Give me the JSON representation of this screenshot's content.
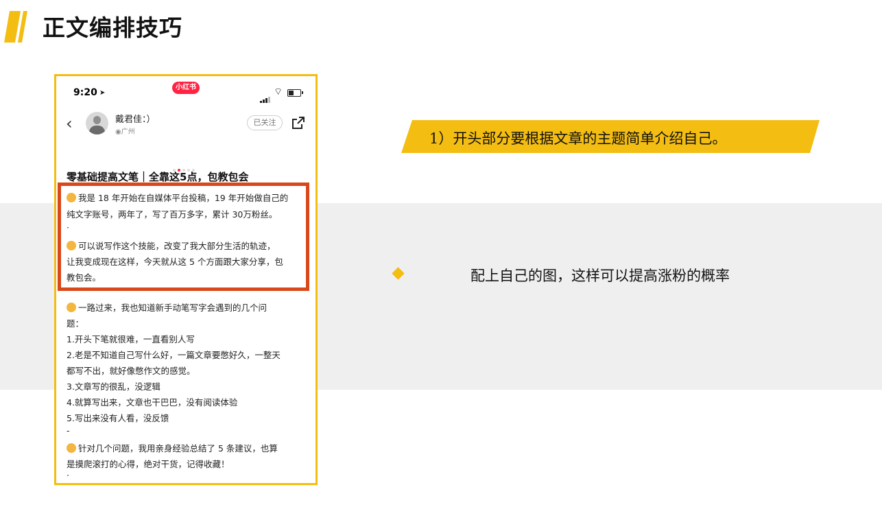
{
  "page": {
    "title": "正文编排技巧"
  },
  "phone": {
    "status_time": "9:20",
    "app_badge": "小红书",
    "username": "戴君佳：）",
    "location": "广州",
    "follow_label": "已关注",
    "post_title": "零基础提高文笔｜全靠这5点，包教包会",
    "lines": [
      "我是 18 年开始在自媒体平台投稿，19 年开始做自己的",
      "纯文字账号，两年了，写了百万多字，累计 30万粉丝。",
      "·",
      "可以说写作这个技能，改变了我大部分生活的轨迹，",
      "让我变成现在这样，今天就从这 5 个方面跟大家分享，包",
      "教包会。",
      "一路过来，我也知道新手动笔写字会遇到的几个问",
      "题：",
      "1.开头下笔就很难，一直看别人写",
      "2.老是不知道自己写什么好，一篇文章要憋好久，一整天",
      "都写不出，就好像憋作文的感觉。",
      "3.文章写的很乱，没逻辑",
      "4.就算写出来，文章也干巴巴，没有阅读体验",
      "5.写出来没有人看，没反馈",
      "-",
      "针对几个问题，我用亲身经验总结了 5 条建议，也算",
      "是摸爬滚打的心得，绝对干货，记得收藏！",
      "·"
    ]
  },
  "right": {
    "banner_text": "1）开头部分要根据文章的主题简单介绍自己。",
    "point_text": "配上自己的图，这样可以提高涨粉的概率"
  },
  "colors": {
    "accent_yellow": "#f4bd12",
    "highlight_red": "#d9481a",
    "brand_red": "#ff2442",
    "band_gray": "#efefef"
  },
  "icons": [
    "back-chevron-icon",
    "share-icon",
    "wifi-icon",
    "battery-icon",
    "signal-icon",
    "location-arrow-icon",
    "diamond-bullet-icon",
    "emoji-icon"
  ]
}
